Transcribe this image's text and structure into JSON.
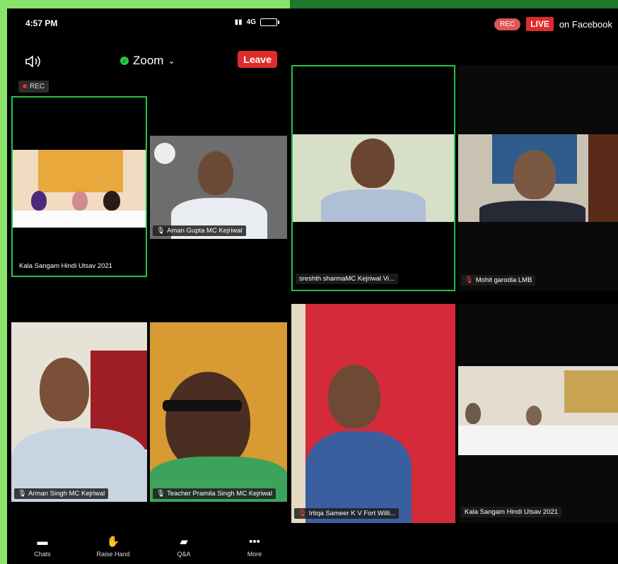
{
  "status_bar": {
    "time": "4:57 PM",
    "signal": "4G"
  },
  "toolbar": {
    "title": "Zoom",
    "leave_label": "Leave",
    "rec_label": "REC"
  },
  "left_tiles": [
    {
      "name": "Kala Sangam Hindi Utsav 2021",
      "mic": "on",
      "active": true
    },
    {
      "name": "Aman Gupta MC Kejriwal",
      "mic": "on",
      "active": false
    },
    {
      "name": "Arman Singh MC Kejriwal",
      "mic": "on",
      "active": false
    },
    {
      "name": "Teacher Pramila Singh MC Kejriwal",
      "mic": "on",
      "active": false
    }
  ],
  "bottom_bar": {
    "items": [
      {
        "label": "Chats",
        "icon": "chat-icon"
      },
      {
        "label": "Raise Hand",
        "icon": "hand-icon"
      },
      {
        "label": "Q&A",
        "icon": "qa-icon"
      },
      {
        "label": "More",
        "icon": "more-icon"
      }
    ]
  },
  "right_header": {
    "rec_label": "REC",
    "live_label": "LIVE",
    "platform_text": "on Facebook"
  },
  "right_tiles": [
    {
      "name": "sreshth sharmaMC Kejriwal Vi...",
      "mic": "on",
      "active": true
    },
    {
      "name": "Mohit garodia LMB",
      "mic": "off",
      "active": false
    },
    {
      "name": "Irtiqa Sameer K V Fort Willi...",
      "mic": "off",
      "active": false
    },
    {
      "name": "Kala Sangam Hindi Utsav 2021",
      "mic": "on",
      "active": false
    }
  ],
  "colors": {
    "active_border": "#22c449",
    "leave_red": "#e02b2b",
    "background_green": "#8be36a"
  }
}
